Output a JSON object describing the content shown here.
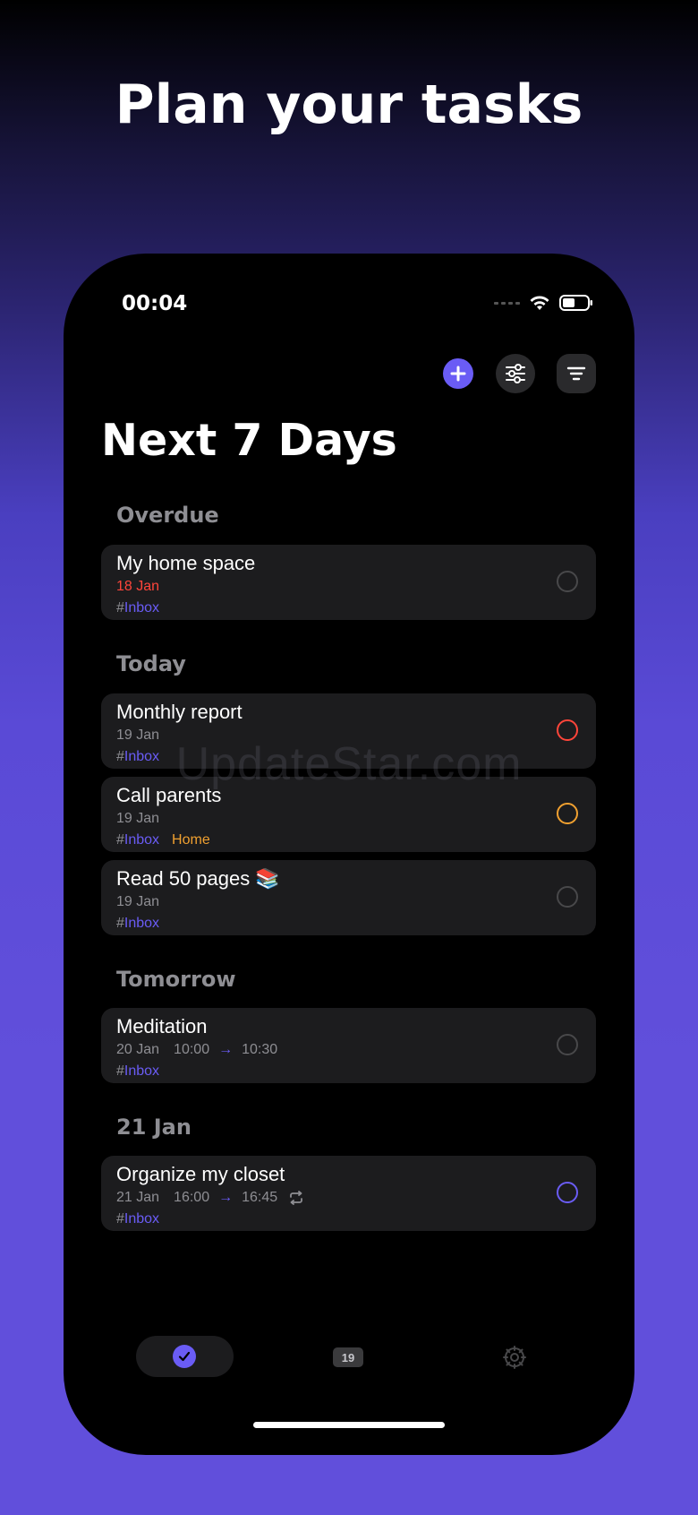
{
  "headline": "Plan your tasks",
  "status_bar": {
    "time": "00:04"
  },
  "header": {
    "title": "Next 7 Days"
  },
  "watermark": "UpdateStar.com",
  "sections": [
    {
      "title": "Overdue",
      "tasks": [
        {
          "title": "My home space",
          "date": "18 Jan",
          "tag_hash": "#",
          "tag": "Inbox"
        }
      ]
    },
    {
      "title": "Today",
      "tasks": [
        {
          "title": "Monthly report",
          "date": "19 Jan",
          "tag_hash": "#",
          "tag": "Inbox"
        },
        {
          "title": "Call parents",
          "date": "19 Jan",
          "tag_hash": "#",
          "tag": "Inbox",
          "label": "Home"
        },
        {
          "title": "Read 50 pages 📚",
          "date": "19 Jan",
          "tag_hash": "#",
          "tag": "Inbox"
        }
      ]
    },
    {
      "title": "Tomorrow",
      "tasks": [
        {
          "title": "Meditation",
          "date": "20 Jan",
          "start": "10:00",
          "arrow": "→",
          "end": "10:30",
          "tag_hash": "#",
          "tag": "Inbox"
        }
      ]
    },
    {
      "title": "21 Jan",
      "tasks": [
        {
          "title": "Organize my closet",
          "date": "21 Jan",
          "start": "16:00",
          "arrow": "→",
          "end": "16:45",
          "tag_hash": "#",
          "tag": "Inbox"
        }
      ]
    }
  ],
  "tabbar": {
    "calendar_day": "19"
  },
  "colors": {
    "accent": "#6a5cf5",
    "overdue": "#ff453a",
    "priority_high": "#ff453a",
    "priority_medium": "#f0a030",
    "label_home": "#f0a030"
  },
  "icons": [
    "add-icon",
    "filter-sliders-icon",
    "sort-icon",
    "wifi-icon",
    "battery-icon",
    "repeat-icon",
    "check-icon",
    "calendar-icon",
    "settings-icon"
  ]
}
